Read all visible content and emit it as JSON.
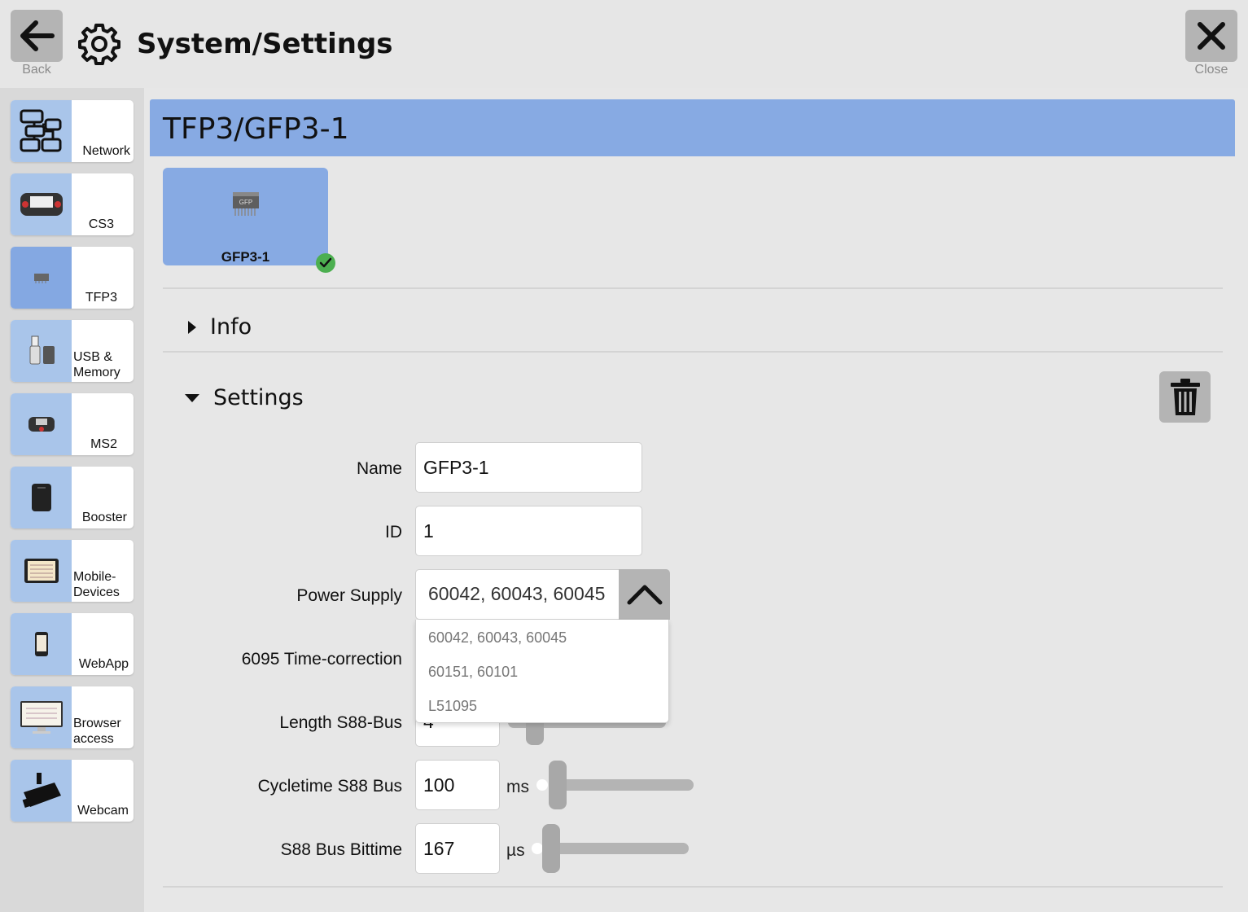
{
  "header": {
    "title": "System/Settings",
    "back_label": "Back",
    "close_label": "Close"
  },
  "sidebar": {
    "items": [
      {
        "label": "Network",
        "icon": "network-icon"
      },
      {
        "label": "CS3",
        "icon": "cs3-icon"
      },
      {
        "label": "TFP3",
        "icon": "tfp3-icon",
        "active": true
      },
      {
        "label": "USB & Memory",
        "icon": "usb-memory-icon"
      },
      {
        "label": "MS2",
        "icon": "ms2-icon"
      },
      {
        "label": "Booster",
        "icon": "booster-icon"
      },
      {
        "label": "Mobile-Devices",
        "icon": "mobile-devices-icon"
      },
      {
        "label": "WebApp",
        "icon": "webapp-icon"
      },
      {
        "label": "Browser access",
        "icon": "browser-access-icon"
      },
      {
        "label": "Webcam",
        "icon": "webcam-icon"
      }
    ]
  },
  "main": {
    "title": "TFP3/GFP3-1",
    "device": {
      "label": "GFP3-1",
      "chip_text": "GFP",
      "status": "ok"
    },
    "info_label": "Info",
    "settings_label": "Settings",
    "form": {
      "name_label": "Name",
      "name_value": "GFP3-1",
      "id_label": "ID",
      "id_value": "1",
      "power_label": "Power Supply",
      "power_value": "60042, 60043, 60045",
      "power_options": [
        "60042, 60043, 60045",
        "60151, 60101",
        "L51095"
      ],
      "time_correction_label": "6095 Time-correction",
      "length_label": "Length S88-Bus",
      "length_value": "4",
      "cycletime_label": "Cycletime S88 Bus",
      "cycletime_value": "100",
      "cycletime_unit": "ms",
      "bittime_label": "S88 Bus Bittime",
      "bittime_value": "167",
      "bittime_unit": "µs"
    }
  },
  "colors": {
    "accent_blue": "#87aae3",
    "thumb_blue": "#a9c5ea",
    "button_gray": "#b4b4b4",
    "ok_green": "#4caf50"
  }
}
